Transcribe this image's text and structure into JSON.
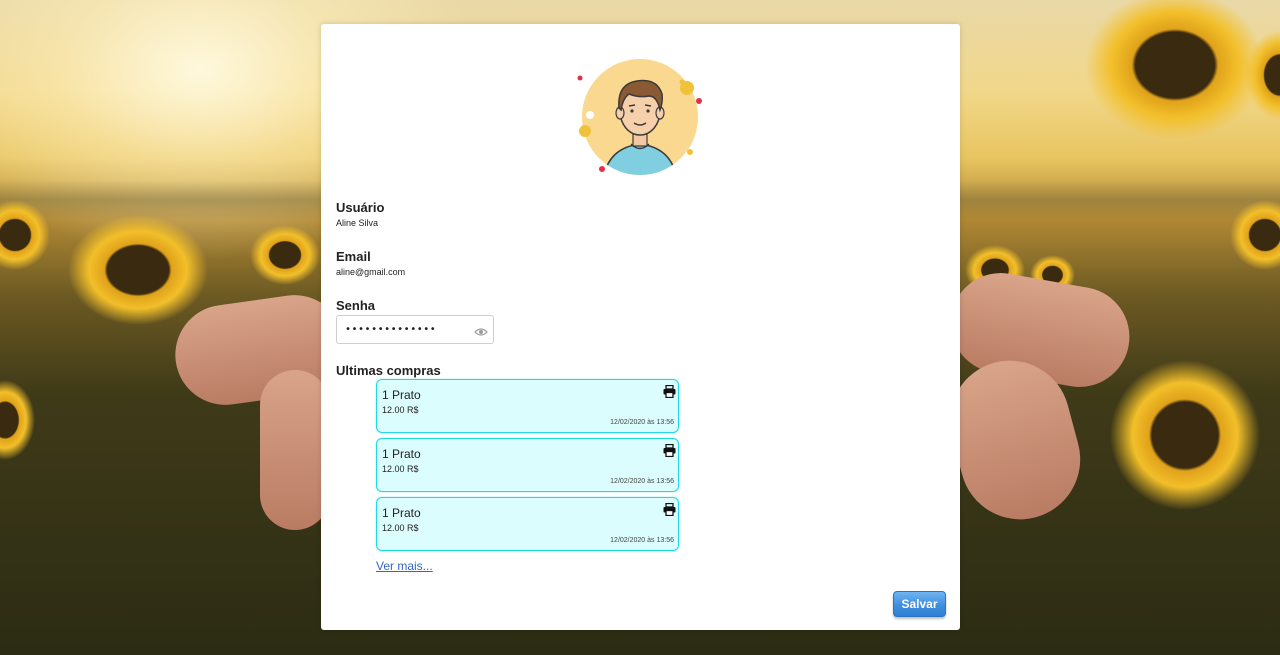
{
  "profile": {
    "user_label": "Usuário",
    "user_value": "Aline Silva",
    "email_label": "Email",
    "email_value": "aline@gmail.com",
    "password_label": "Senha",
    "password_value": "••••••••••••••",
    "purchases_label": "Ultimas compras"
  },
  "purchases": [
    {
      "title": "1 Prato",
      "price": "12.00 R$",
      "date": "12/02/2020 às 13:56"
    },
    {
      "title": "1 Prato",
      "price": "12.00 R$",
      "date": "12/02/2020 às 13:56"
    },
    {
      "title": "1 Prato",
      "price": "12.00 R$",
      "date": "12/02/2020 às 13:56"
    }
  ],
  "actions": {
    "see_more": "Ver mais...",
    "save": "Salvar"
  },
  "icons": {
    "avatar": "user-avatar-icon",
    "password_toggle": "eye-icon",
    "print": "printer-icon"
  },
  "colors": {
    "purchase_bg": "#dcfdfd",
    "purchase_border": "#22d8e6",
    "save_button": "#3f8fe0",
    "link": "#3366cc"
  }
}
